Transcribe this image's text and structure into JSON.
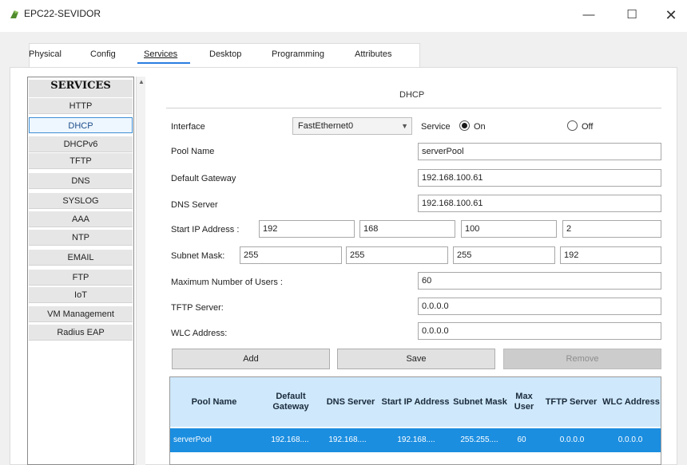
{
  "window": {
    "title": "EPC22-SEVIDOR",
    "minimize": "—",
    "maximize": "☐",
    "close": "✕"
  },
  "tabs": [
    "Physical",
    "Config",
    "Services",
    "Desktop",
    "Programming",
    "Attributes"
  ],
  "active_tab": "Services",
  "sidebar": {
    "title": "SERVICES",
    "items": [
      "HTTP",
      "DHCP",
      "DHCPv6",
      "TFTP",
      "DNS",
      "SYSLOG",
      "AAA",
      "NTP",
      "EMAIL",
      "FTP",
      "IoT",
      "VM Management",
      "Radius EAP"
    ],
    "selected": "DHCP"
  },
  "dhcp": {
    "section_title": "DHCP",
    "interface_label": "Interface",
    "interface_value": "FastEthernet0",
    "service_label": "Service",
    "on_label": "On",
    "off_label": "Off",
    "service_state": "On",
    "pool_name_label": "Pool Name",
    "pool_name_value": "serverPool",
    "gateway_label": "Default Gateway",
    "gateway_value": "192.168.100.61",
    "dns_label": "DNS Server",
    "dns_value": "192.168.100.61",
    "start_ip_label": "Start IP Address :",
    "start_ip": [
      "192",
      "168",
      "100",
      "2"
    ],
    "subnet_label": "Subnet Mask:",
    "subnet": [
      "255",
      "255",
      "255",
      "192"
    ],
    "max_users_label": "Maximum Number of Users :",
    "max_users_value": "60",
    "tftp_label": "TFTP Server:",
    "tftp_value": "0.0.0.0",
    "wlc_label": "WLC Address:",
    "wlc_value": "0.0.0.0",
    "buttons": {
      "add": "Add",
      "save": "Save",
      "remove": "Remove"
    }
  },
  "table": {
    "headers": [
      "Pool Name",
      "Default Gateway",
      "DNS Server",
      "Start IP Address",
      "Subnet Mask",
      "Max User",
      "TFTP Server",
      "WLC Address"
    ],
    "rows": [
      [
        "serverPool",
        "192.168....",
        "192.168....",
        "192.168....",
        "255.255....",
        "60",
        "0.0.0.0",
        "0.0.0.0"
      ]
    ]
  },
  "colors": {
    "selection_blue": "#1b8ee0",
    "header_light_blue": "#cfe8fb",
    "tab_underline": "#2a7de1"
  }
}
